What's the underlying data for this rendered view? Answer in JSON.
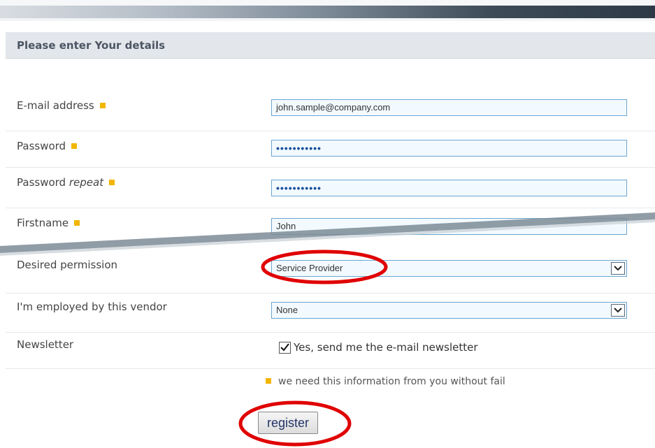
{
  "form": {
    "title": "Please enter Your details",
    "fields": {
      "email": {
        "label": "E-mail address",
        "value": "john.sample@company.com"
      },
      "password": {
        "label": "Password",
        "value": "•••••••••••"
      },
      "password_repeat": {
        "label_main": "Password",
        "label_em": "repeat",
        "value": "•••••••••••"
      },
      "firstname": {
        "label": "Firstname",
        "value": "John"
      },
      "permission": {
        "label": "Desired permission",
        "selected": "Service Provider"
      },
      "vendor": {
        "label": "I'm employed by this vendor",
        "selected": "None"
      },
      "newsletter": {
        "label": "Newsletter",
        "checkbox_label": "Yes, send me the e-mail newsletter",
        "checked": true
      }
    },
    "required_note": "we need this information from you without fail",
    "register_label": "register"
  },
  "colors": {
    "required_marker": "#f2b500",
    "field_border": "#6aa5cf",
    "field_bg": "#f2faff",
    "header_bg": "#e3e7ec",
    "annotation": "#e00000"
  },
  "icons": {
    "required": "required-marker-icon",
    "dropdown": "chevron-down-icon",
    "checkbox": "check-icon"
  }
}
